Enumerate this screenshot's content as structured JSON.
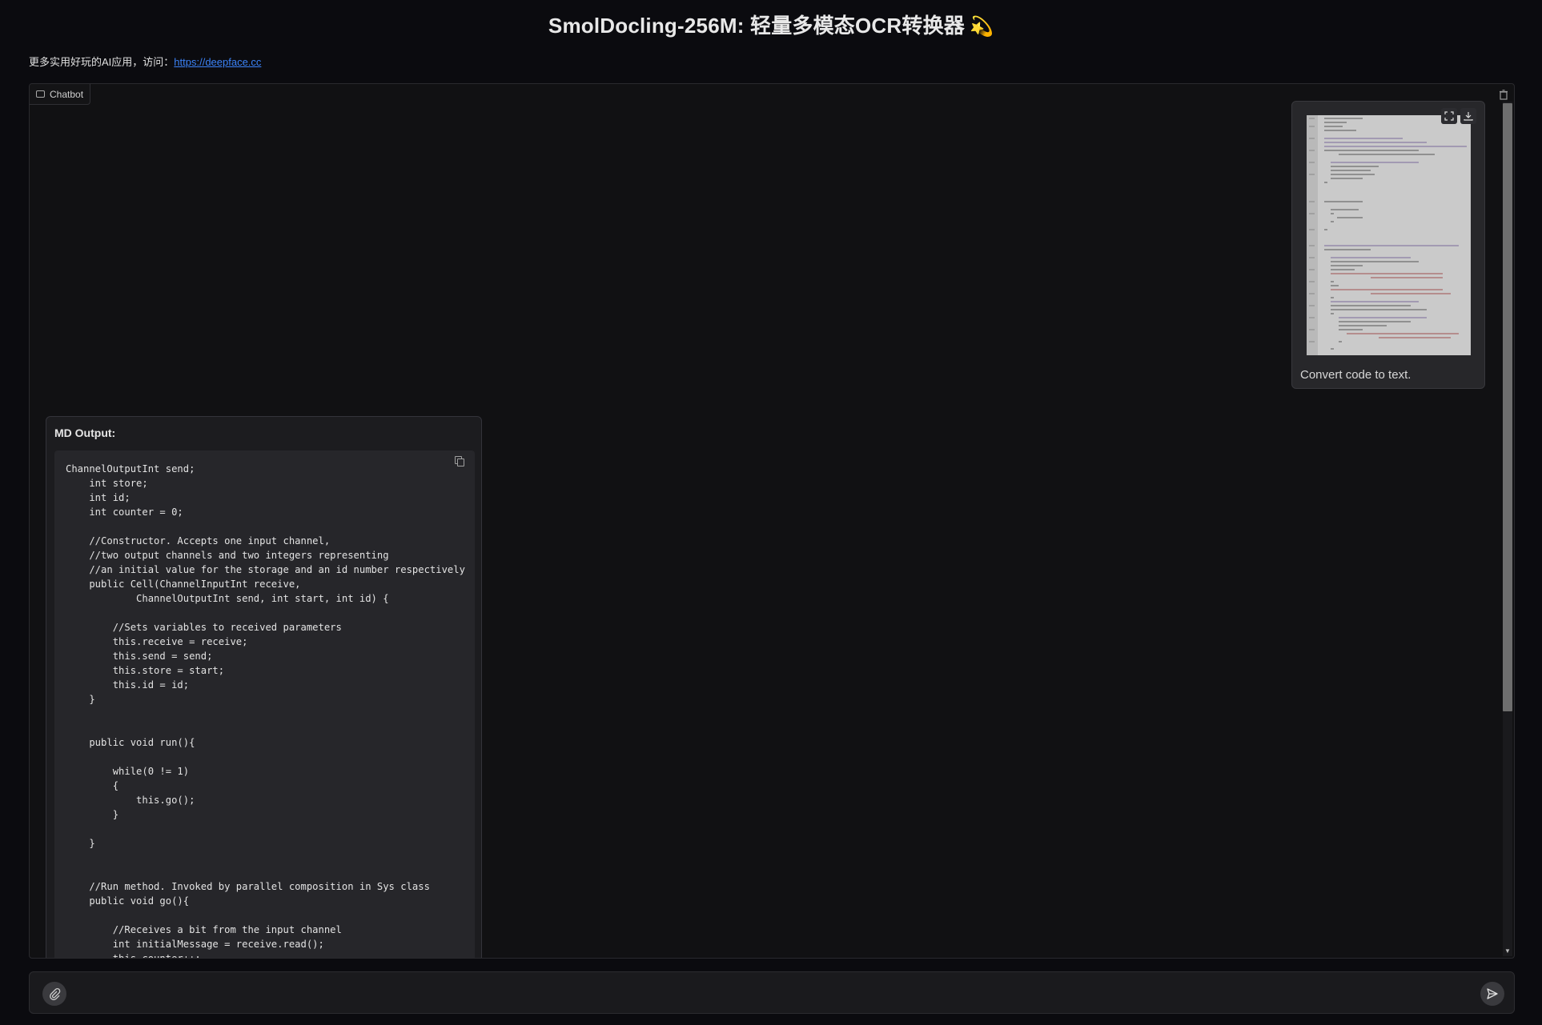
{
  "header": {
    "title": "SmolDocling-256M: 轻量多模态OCR转换器",
    "title_emoji": "💫",
    "subtitle_prefix": "更多实用好玩的AI应用，访问：",
    "subtitle_link": "https://deepface.cc"
  },
  "chatbot": {
    "label": "Chatbot",
    "label_icon": "chat-bubble-icon",
    "clear_icon": "trash-icon",
    "user_message": {
      "image_alt": "Java code screenshot",
      "caption": "Convert code to text."
    },
    "bot_message": {
      "heading": "MD Output:",
      "code": "ChannelOutputInt send;\n    int store;\n    int id;\n    int counter = 0;\n\n    //Constructor. Accepts one input channel,\n    //two output channels and two integers representing\n    //an initial value for the storage and an id number respectively\n    public Cell(ChannelInputInt receive,\n            ChannelOutputInt send, int start, int id) {\n\n        //Sets variables to received parameters\n        this.receive = receive;\n        this.send = send;\n        this.store = start;\n        this.id = id;\n    }\n\n\n    public void run(){\n\n        while(0 != 1)\n        {\n            this.go();\n        }\n\n    }\n\n\n    //Run method. Invoked by parallel composition in Sys class\n    public void go(){\n\n        //Receives a bit from the input channel\n        int initialMessage = receive.read();\n        this.counter++;"
    }
  },
  "input": {
    "placeholder": "",
    "attach_icon": "paperclip-icon",
    "send_icon": "send-icon"
  }
}
